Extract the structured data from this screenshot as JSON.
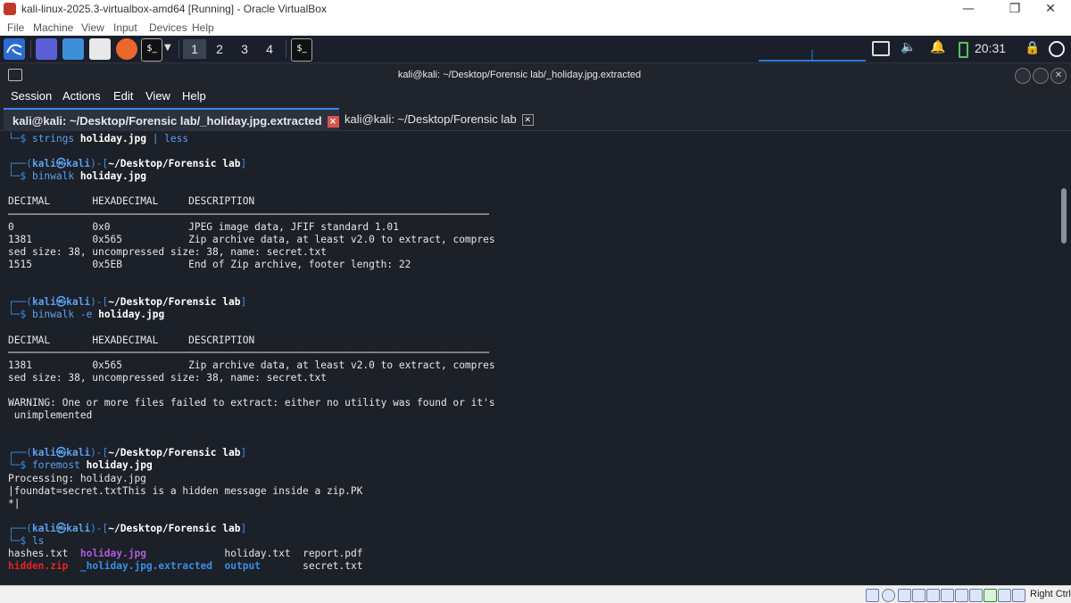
{
  "host": {
    "title": "kali-linux-2025.3-virtualbox-amd64 [Running] - Oracle VirtualBox",
    "menu": [
      "File",
      "Machine",
      "View",
      "Input",
      "Devices",
      "Help"
    ],
    "status_right": "Right Ctrl"
  },
  "panel": {
    "workspaces": [
      "1",
      "2",
      "3",
      "4"
    ],
    "active_workspace": "1",
    "clock": "20:31"
  },
  "terminal": {
    "title": "kali@kali: ~/Desktop/Forensic lab/_holiday.jpg.extracted",
    "menu": [
      "Session",
      "Actions",
      "Edit",
      "View",
      "Help"
    ],
    "tabs": [
      {
        "label": "kali@kali: ~/Desktop/Forensic lab/_holiday.jpg.extracted",
        "active": true
      },
      {
        "label": "kali@kali: ~/Desktop/Forensic lab",
        "active": false
      }
    ],
    "prompt_user": "kali",
    "prompt_host": "kali",
    "prompt_path": "~/Desktop/Forensic lab",
    "session": {
      "first_cmd": {
        "cmd": "strings",
        "arg": "holiday.jpg",
        "pipe": "| less"
      },
      "binwalk1": {
        "cmd": "binwalk",
        "arg": "holiday.jpg",
        "header": [
          "DECIMAL",
          "HEXADECIMAL",
          "DESCRIPTION"
        ],
        "rows": [
          [
            "0",
            "0x0",
            "JPEG image data, JFIF standard 1.01"
          ],
          [
            "1381",
            "0x565",
            "Zip archive data, at least v2.0 to extract, compres"
          ],
          [
            "",
            "",
            "sed size: 38, uncompressed size: 38, name: secret.txt"
          ],
          [
            "1515",
            "0x5EB",
            "End of Zip archive, footer length: 22"
          ]
        ]
      },
      "binwalk2": {
        "cmd": "binwalk",
        "flag": "-e",
        "arg": "holiday.jpg",
        "header": [
          "DECIMAL",
          "HEXADECIMAL",
          "DESCRIPTION"
        ],
        "rows": [
          [
            "1381",
            "0x565",
            "Zip archive data, at least v2.0 to extract, compres"
          ],
          [
            "",
            "",
            "sed size: 38, uncompressed size: 38, name: secret.txt"
          ]
        ],
        "warning1": "WARNING: One or more files failed to extract: either no utility was found or it's",
        "warning2": " unimplemented"
      },
      "foremost": {
        "cmd": "foremost",
        "arg": "holiday.jpg",
        "out1": "Processing: holiday.jpg",
        "out2": "|foundat=secret.txtThis is a hidden message inside a zip.PK",
        "out3": "*|"
      },
      "ls": {
        "cmd": "ls",
        "files": {
          "hashes": "hashes.txt",
          "holiday_jpg": "holiday.jpg",
          "holiday_txt": "holiday.txt",
          "report": "report.pdf",
          "hidden_zip": "hidden.zip",
          "extracted_dir": "_holiday.jpg.extracted",
          "output_dir": "output",
          "secret": "secret.txt"
        }
      }
    }
  }
}
